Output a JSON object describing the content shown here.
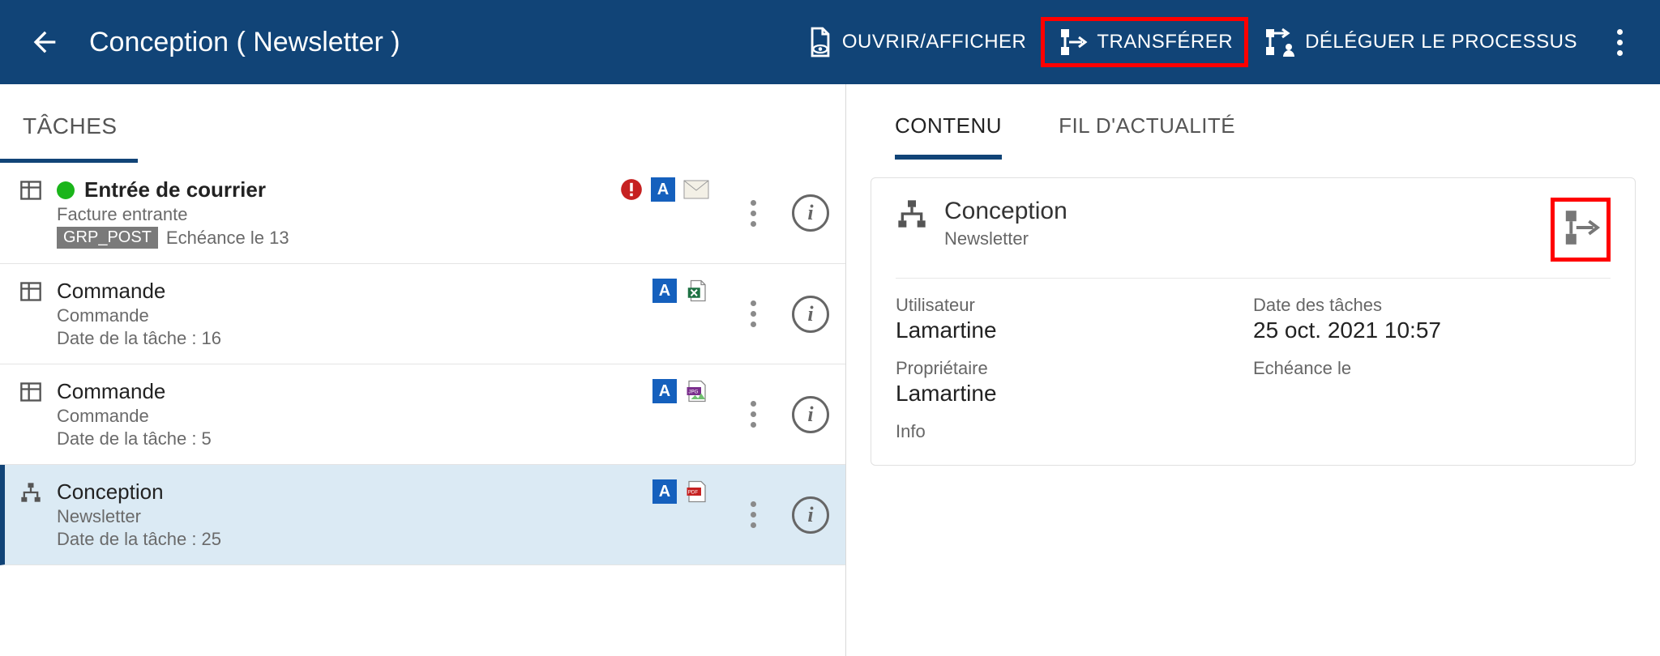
{
  "header": {
    "title": "Conception ( Newsletter )",
    "open": "OUVRIR/AFFICHER",
    "transfer": "TRANSFÉRER",
    "delegate": "DÉLÉGUER LE PROCESSUS"
  },
  "left": {
    "heading": "TÂCHES",
    "items": [
      {
        "title": "Entrée de courrier",
        "bold": true,
        "sub": "Facture entrante",
        "tag": "GRP_POST",
        "meta": "Echéance le 13",
        "greenDot": true,
        "alert": true,
        "badgeA": true,
        "mail": true
      },
      {
        "title": "Commande",
        "sub": "Commande",
        "meta": "Date de la tâche : 16",
        "badgeA": true,
        "excel": true
      },
      {
        "title": "Commande",
        "sub": "Commande",
        "meta": "Date de la tâche : 5",
        "badgeA": true,
        "jpg": true
      },
      {
        "title": "Conception",
        "sub": "Newsletter",
        "meta": "Date de la tâche : 25",
        "badgeA": true,
        "pdf": true,
        "selected": true,
        "flowIcon": true
      }
    ]
  },
  "right": {
    "tabs": {
      "content": "CONTENU",
      "feed": "FIL D'ACTUALITÉ"
    },
    "card": {
      "title": "Conception",
      "sub": "Newsletter",
      "userLabel": "Utilisateur",
      "userValue": "Lamartine",
      "dateLabel": "Date des tâches",
      "dateValue": "25 oct. 2021 10:57",
      "ownerLabel": "Propriétaire",
      "ownerValue": "Lamartine",
      "dueLabel": "Echéance le",
      "dueValue": "",
      "infoLabel": "Info"
    }
  }
}
